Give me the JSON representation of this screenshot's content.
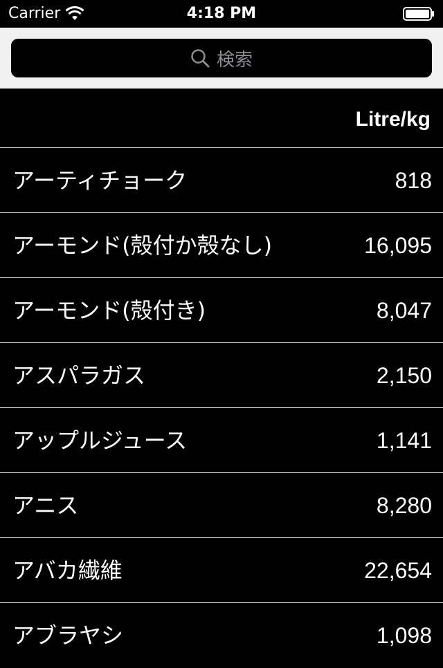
{
  "status_bar": {
    "carrier": "Carrier",
    "time": "4:18 PM",
    "icons": [
      "wifi-icon",
      "battery-icon"
    ]
  },
  "search": {
    "placeholder": "検索",
    "icon": "search-icon"
  },
  "table": {
    "header": "Litre/kg",
    "rows": [
      {
        "name": "アーティチョーク",
        "value": "818"
      },
      {
        "name": "アーモンド(殻付か殻なし)",
        "value": "16,095"
      },
      {
        "name": "アーモンド(殻付き)",
        "value": "8,047"
      },
      {
        "name": "アスパラガス",
        "value": "2,150"
      },
      {
        "name": "アップルジュース",
        "value": "1,141"
      },
      {
        "name": "アニス",
        "value": "8,280"
      },
      {
        "name": "アバカ繊維",
        "value": "22,654"
      },
      {
        "name": "アブラヤシ",
        "value": "1,098"
      }
    ]
  }
}
